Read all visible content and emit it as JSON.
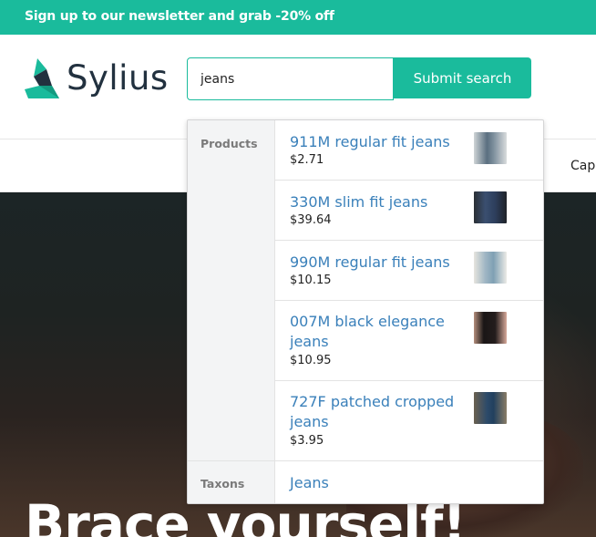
{
  "promo": {
    "text": "Sign up to our newsletter and grab -20% off"
  },
  "header": {
    "logo_text": "Sylius"
  },
  "search": {
    "value": "jeans",
    "submit_label": "Submit search"
  },
  "nav": {
    "partial_item": "Cap"
  },
  "hero": {
    "title": "Brace yourself!"
  },
  "dropdown": {
    "products_label": "Products",
    "taxons_label": "Taxons",
    "products": [
      {
        "name": "911M regular fit jeans",
        "price": "$2.71"
      },
      {
        "name": "330M slim fit jeans",
        "price": "$39.64"
      },
      {
        "name": "990M regular fit jeans",
        "price": "$10.15"
      },
      {
        "name": "007M black elegance jeans",
        "price": "$10.95"
      },
      {
        "name": "727F patched cropped jeans",
        "price": "$3.95"
      }
    ],
    "taxons": [
      {
        "name": "Jeans"
      }
    ]
  },
  "colors": {
    "brand": "#1abb9c",
    "link": "#3a80ba",
    "logo_dark": "#22313f"
  }
}
